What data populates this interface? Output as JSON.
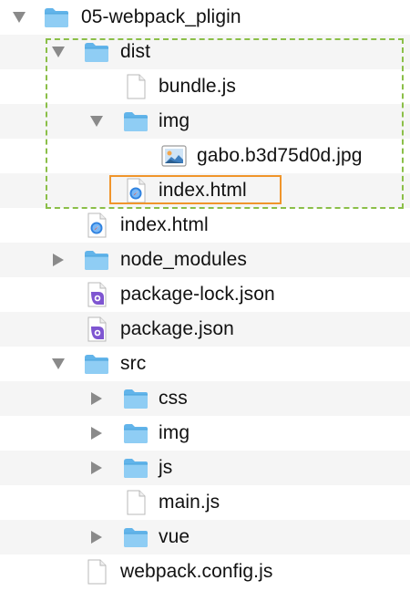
{
  "colors": {
    "folder": "#62b4ea",
    "row_alt": "#f5f5f5",
    "dist_outline": "#8bbf48",
    "selection_outline": "#f0952b"
  },
  "tree": [
    {
      "name": "05-webpack_pligin",
      "kind": "folder",
      "depth": 0,
      "expanded": true
    },
    {
      "name": "dist",
      "kind": "folder",
      "depth": 1,
      "expanded": true
    },
    {
      "name": "bundle.js",
      "kind": "file",
      "depth": 2
    },
    {
      "name": "img",
      "kind": "folder",
      "depth": 2,
      "expanded": true
    },
    {
      "name": "gabo.b3d75d0d.jpg",
      "kind": "image",
      "depth": 3
    },
    {
      "name": "index.html",
      "kind": "html",
      "depth": 2
    },
    {
      "name": "index.html",
      "kind": "html",
      "depth": 1
    },
    {
      "name": "node_modules",
      "kind": "folder",
      "depth": 1,
      "expanded": false
    },
    {
      "name": "package-lock.json",
      "kind": "json",
      "depth": 1
    },
    {
      "name": "package.json",
      "kind": "json",
      "depth": 1
    },
    {
      "name": "src",
      "kind": "folder",
      "depth": 1,
      "expanded": true
    },
    {
      "name": "css",
      "kind": "folder",
      "depth": 2,
      "expanded": false
    },
    {
      "name": "img",
      "kind": "folder",
      "depth": 2,
      "expanded": false
    },
    {
      "name": "js",
      "kind": "folder",
      "depth": 2,
      "expanded": false
    },
    {
      "name": "main.js",
      "kind": "file",
      "depth": 2
    },
    {
      "name": "vue",
      "kind": "folder",
      "depth": 2,
      "expanded": false
    },
    {
      "name": "webpack.config.js",
      "kind": "file",
      "depth": 1
    }
  ]
}
